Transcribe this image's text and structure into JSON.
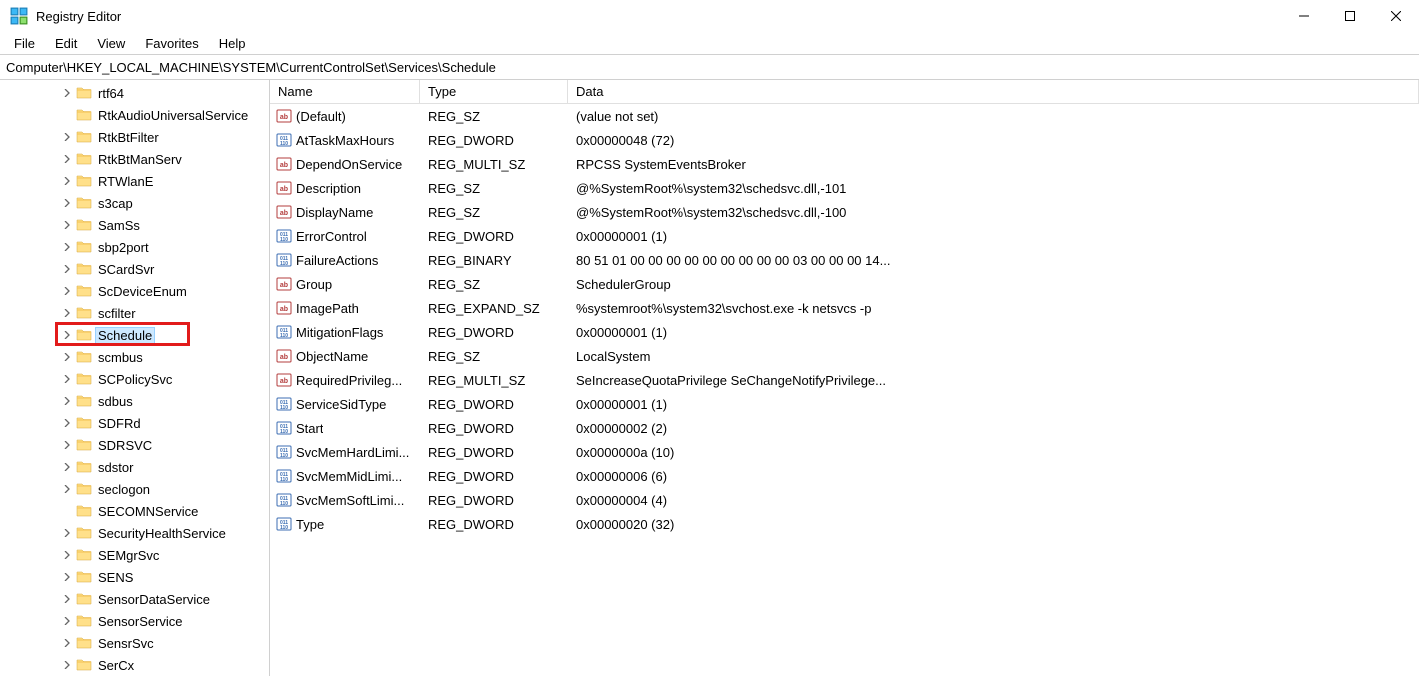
{
  "window": {
    "title": "Registry Editor"
  },
  "menu": {
    "file": "File",
    "edit": "Edit",
    "view": "View",
    "favorites": "Favorites",
    "help": "Help"
  },
  "address": "Computer\\HKEY_LOCAL_MACHINE\\SYSTEM\\CurrentControlSet\\Services\\Schedule",
  "tree": [
    {
      "label": "rtf64",
      "expandable": true
    },
    {
      "label": "RtkAudioUniversalService",
      "expandable": false
    },
    {
      "label": "RtkBtFilter",
      "expandable": true
    },
    {
      "label": "RtkBtManServ",
      "expandable": true
    },
    {
      "label": "RTWlanE",
      "expandable": true
    },
    {
      "label": "s3cap",
      "expandable": true
    },
    {
      "label": "SamSs",
      "expandable": true
    },
    {
      "label": "sbp2port",
      "expandable": true
    },
    {
      "label": "SCardSvr",
      "expandable": true
    },
    {
      "label": "ScDeviceEnum",
      "expandable": true
    },
    {
      "label": "scfilter",
      "expandable": true
    },
    {
      "label": "Schedule",
      "expandable": true,
      "selected": true,
      "highlighted": true
    },
    {
      "label": "scmbus",
      "expandable": true
    },
    {
      "label": "SCPolicySvc",
      "expandable": true
    },
    {
      "label": "sdbus",
      "expandable": true
    },
    {
      "label": "SDFRd",
      "expandable": true
    },
    {
      "label": "SDRSVC",
      "expandable": true
    },
    {
      "label": "sdstor",
      "expandable": true
    },
    {
      "label": "seclogon",
      "expandable": true
    },
    {
      "label": "SECOMNService",
      "expandable": false
    },
    {
      "label": "SecurityHealthService",
      "expandable": true
    },
    {
      "label": "SEMgrSvc",
      "expandable": true
    },
    {
      "label": "SENS",
      "expandable": true
    },
    {
      "label": "SensorDataService",
      "expandable": true
    },
    {
      "label": "SensorService",
      "expandable": true
    },
    {
      "label": "SensrSvc",
      "expandable": true
    },
    {
      "label": "SerCx",
      "expandable": true
    }
  ],
  "columns": {
    "name": "Name",
    "type": "Type",
    "data": "Data"
  },
  "values": [
    {
      "icon": "sz",
      "name": "(Default)",
      "type": "REG_SZ",
      "data": "(value not set)"
    },
    {
      "icon": "dw",
      "name": "AtTaskMaxHours",
      "type": "REG_DWORD",
      "data": "0x00000048 (72)"
    },
    {
      "icon": "sz",
      "name": "DependOnService",
      "type": "REG_MULTI_SZ",
      "data": "RPCSS SystemEventsBroker"
    },
    {
      "icon": "sz",
      "name": "Description",
      "type": "REG_SZ",
      "data": "@%SystemRoot%\\system32\\schedsvc.dll,-101"
    },
    {
      "icon": "sz",
      "name": "DisplayName",
      "type": "REG_SZ",
      "data": "@%SystemRoot%\\system32\\schedsvc.dll,-100"
    },
    {
      "icon": "dw",
      "name": "ErrorControl",
      "type": "REG_DWORD",
      "data": "0x00000001 (1)"
    },
    {
      "icon": "dw",
      "name": "FailureActions",
      "type": "REG_BINARY",
      "data": "80 51 01 00 00 00 00 00 00 00 00 00 03 00 00 00 14..."
    },
    {
      "icon": "sz",
      "name": "Group",
      "type": "REG_SZ",
      "data": "SchedulerGroup"
    },
    {
      "icon": "sz",
      "name": "ImagePath",
      "type": "REG_EXPAND_SZ",
      "data": "%systemroot%\\system32\\svchost.exe -k netsvcs -p"
    },
    {
      "icon": "dw",
      "name": "MitigationFlags",
      "type": "REG_DWORD",
      "data": "0x00000001 (1)"
    },
    {
      "icon": "sz",
      "name": "ObjectName",
      "type": "REG_SZ",
      "data": "LocalSystem"
    },
    {
      "icon": "sz",
      "name": "RequiredPrivileg...",
      "type": "REG_MULTI_SZ",
      "data": "SeIncreaseQuotaPrivilege SeChangeNotifyPrivilege..."
    },
    {
      "icon": "dw",
      "name": "ServiceSidType",
      "type": "REG_DWORD",
      "data": "0x00000001 (1)"
    },
    {
      "icon": "dw",
      "name": "Start",
      "type": "REG_DWORD",
      "data": "0x00000002 (2)"
    },
    {
      "icon": "dw",
      "name": "SvcMemHardLimi...",
      "type": "REG_DWORD",
      "data": "0x0000000a (10)"
    },
    {
      "icon": "dw",
      "name": "SvcMemMidLimi...",
      "type": "REG_DWORD",
      "data": "0x00000006 (6)"
    },
    {
      "icon": "dw",
      "name": "SvcMemSoftLimi...",
      "type": "REG_DWORD",
      "data": "0x00000004 (4)"
    },
    {
      "icon": "dw",
      "name": "Type",
      "type": "REG_DWORD",
      "data": "0x00000020 (32)"
    }
  ]
}
